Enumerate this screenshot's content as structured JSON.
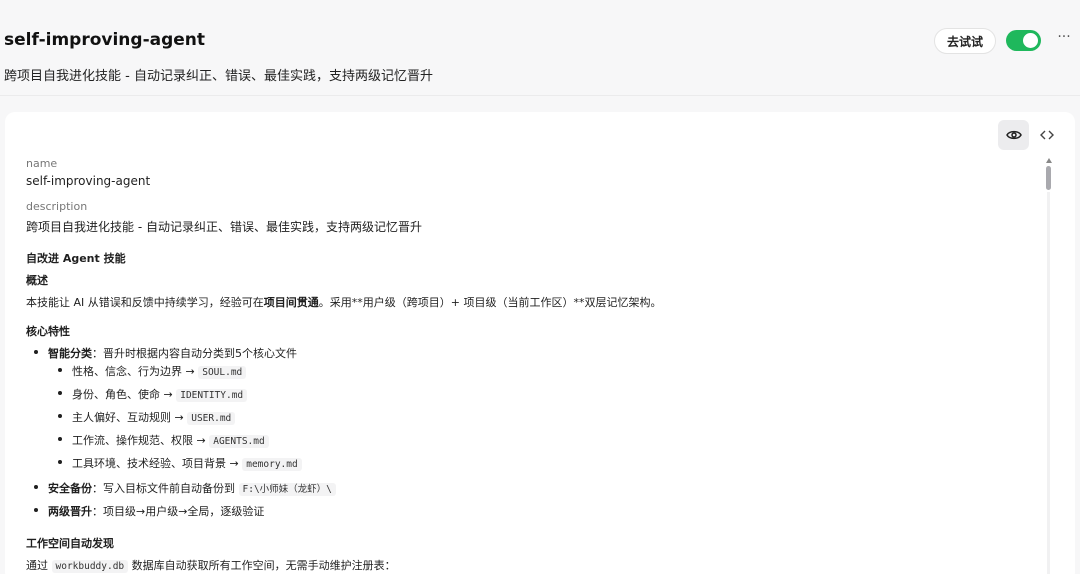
{
  "header": {
    "title": "self-improving-agent",
    "subtitle": "跨项目自我进化技能 - 自动记录纠正、错误、最佳实践，支持两级记忆晋升",
    "try_label": "去试试",
    "toggle_on": true,
    "more_label": "···"
  },
  "meta": {
    "name_label": "name",
    "name_value": "self-improving-agent",
    "description_label": "description",
    "description_value": "跨项目自我进化技能 - 自动记录纠正、错误、最佳实践，支持两级记忆晋升"
  },
  "doc": {
    "heading": "自改进 Agent 技能",
    "overview_title": "概述",
    "overview_pre": "本技能让 AI 从错误和反馈中持续学习，经验可在",
    "overview_bold": "项目间贯通",
    "overview_post": "。采用**用户级（跨项目）+ 项目级（当前工作区）**双层记忆架构。",
    "features_title": "核心特性",
    "feature1_bold": "智能分类",
    "feature1_text": "：晋升时根据内容自动分类到5个核心文件",
    "sub_items": [
      {
        "text": "性格、信念、行为边界 →",
        "code": "SOUL.md"
      },
      {
        "text": "身份、角色、使命 →",
        "code": "IDENTITY.md"
      },
      {
        "text": "主人偏好、互动规则 →",
        "code": "USER.md"
      },
      {
        "text": "工作流、操作规范、权限 →",
        "code": "AGENTS.md"
      },
      {
        "text": "工具环境、技术经验、项目背景 →",
        "code": "memory.md"
      }
    ],
    "feature2_bold": "安全备份",
    "feature2_text": "：写入目标文件前自动备份到",
    "feature2_code": "F:\\小师妹（龙虾）\\",
    "feature3_bold": "两级晋升",
    "feature3_text": "：项目级→用户级→全局，逐级验证",
    "workspace_title": "工作空间自动发现",
    "workspace_pre": "通过",
    "workspace_code": "workbuddy.db",
    "workspace_post": "数据库自动获取所有工作空间，无需手动维护注册表："
  },
  "colors": {
    "toggle": "#1fb85c",
    "background": "#f7f7f8",
    "card": "#ffffff"
  },
  "icons": {
    "view": "eye-icon",
    "code": "code-icon",
    "more": "more-icon"
  }
}
